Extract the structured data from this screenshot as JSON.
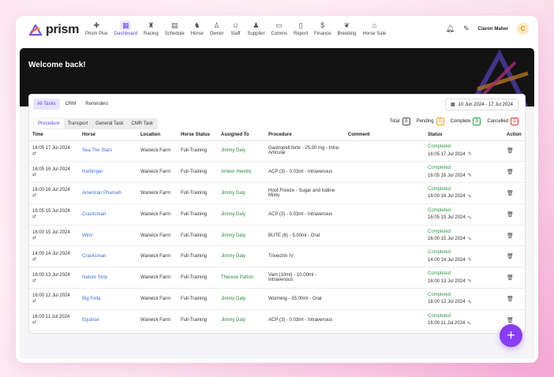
{
  "brand": {
    "name": "prism"
  },
  "nav": [
    {
      "label": "Prism Plus",
      "icon": "plus-icon"
    },
    {
      "label": "Dashboard",
      "icon": "dashboard-icon",
      "active": true
    },
    {
      "label": "Racing",
      "icon": "trophy-icon"
    },
    {
      "label": "Schedule",
      "icon": "calendar-icon"
    },
    {
      "label": "Horse",
      "icon": "horse-icon"
    },
    {
      "label": "Owner",
      "icon": "user-icon"
    },
    {
      "label": "Staff",
      "icon": "users-icon"
    },
    {
      "label": "Supplier",
      "icon": "supplier-icon"
    },
    {
      "label": "Comms",
      "icon": "chat-icon"
    },
    {
      "label": "Report",
      "icon": "clipboard-icon"
    },
    {
      "label": "Finance",
      "icon": "dollar-icon"
    },
    {
      "label": "Breeding",
      "icon": "breeding-icon"
    },
    {
      "label": "Horse Sale",
      "icon": "horse-sale-icon"
    }
  ],
  "user": {
    "name": "Ciaron Maher",
    "initial": "C"
  },
  "hero": {
    "title": "Welcome back!"
  },
  "tabs": [
    "All Tasks",
    "CRM",
    "Reminders"
  ],
  "date_range": "10 Jun 2024 - 17 Jul 2024",
  "subtabs": [
    "Procedure",
    "Transport",
    "General Task",
    "CMR Task"
  ],
  "counters": [
    {
      "label": "Total",
      "value": "9",
      "color": "#555555"
    },
    {
      "label": "Pending",
      "value": "0",
      "color": "#f0a020"
    },
    {
      "label": "Complete",
      "value": "9",
      "color": "#2e9d4c"
    },
    {
      "label": "Cancelled",
      "value": "0",
      "color": "#e04040"
    }
  ],
  "columns": [
    "Time",
    "Horse",
    "Location",
    "Horse Status",
    "Assigned To",
    "Procedure",
    "Comment",
    "Status",
    "Action"
  ],
  "rows": [
    {
      "time": "16:05 17 Jul 2024",
      "horse": "Sea The Stars",
      "location": "Warwick Farm",
      "horse_status": "Full-Training",
      "assigned": "Jimmy Daly",
      "procedure": "Gastropell forte - 25.00 mg - Intra-Articular",
      "comment": "",
      "status": "Completed",
      "status_time": "16:05 17 Jul 2024"
    },
    {
      "time": "16:05 16 Jul 2024",
      "horse": "Harbinger",
      "location": "Warwick Farm",
      "horse_status": "Full-Training",
      "assigned": "Amber Hendry",
      "procedure": "ACP (3) - 0.03ml - Intravenous",
      "comment": "",
      "status": "Completed",
      "status_time": "16:05 16 Jul 2024"
    },
    {
      "time": "16:00 16 Jul 2024",
      "horse": "American Pharoah",
      "location": "Warwick Farm",
      "horse_status": "Full-Training",
      "assigned": "Jimmy Daly",
      "procedure": "Hoof Freeze - Sugar and Iodine Mixtu",
      "comment": "",
      "status": "Completed",
      "status_time": "16:00 16 Jul 2024"
    },
    {
      "time": "16:05 15 Jul 2024",
      "horse": "Cracksman",
      "location": "Warwick Farm",
      "horse_status": "Full-Training",
      "assigned": "Jimmy Daly",
      "procedure": "ACP (3) - 0.03ml - Intravenous",
      "comment": "",
      "status": "Completed",
      "status_time": "16:05 15 Jul 2024"
    },
    {
      "time": "16:00 15 Jul 2024",
      "horse": "Winx",
      "location": "Warwick Farm",
      "horse_status": "Full-Training",
      "assigned": "Jimmy Daly",
      "procedure": "BUTE (6) - 5.00ml - Oral",
      "comment": "",
      "status": "Completed",
      "status_time": "16:00 15 Jul 2024"
    },
    {
      "time": "14:00 14 Jul 2024",
      "horse": "Cracksman",
      "location": "Warwick Farm",
      "horse_status": "Full-Training",
      "assigned": "Jimmy Daly",
      "procedure": "Trivectrin IV",
      "comment": "",
      "status": "Completed",
      "status_time": "14:00 14 Jul 2024"
    },
    {
      "time": "16:00 13 Jul 2024",
      "horse": "Nature Strip",
      "location": "Warwick Farm",
      "horse_status": "Full-Training",
      "assigned": "Therese Patton",
      "procedure": "Vam (10ml) - 10.00ml - Intravenous",
      "comment": "",
      "status": "Completed",
      "status_time": "16:00 13 Jul 2024"
    },
    {
      "time": "16:00 12 Jul 2024",
      "horse": "Big Fella",
      "location": "Warwick Farm",
      "horse_status": "Full-Training",
      "assigned": "Jimmy Daly",
      "procedure": "Worming - 35.00ml - Oral",
      "comment": "",
      "status": "Completed",
      "status_time": "16:00 12 Jul 2024"
    },
    {
      "time": "16:00 11 Jul 2024",
      "horse": "Equinox",
      "location": "Warwick Farm",
      "horse_status": "Full-Training",
      "assigned": "Jimmy Daly",
      "procedure": "ACP (3) - 0.03ml - Intravenous",
      "comment": "",
      "status": "Completed",
      "status_time": "16:00 11 Jul 2024"
    }
  ],
  "fab": {
    "label": "+"
  }
}
